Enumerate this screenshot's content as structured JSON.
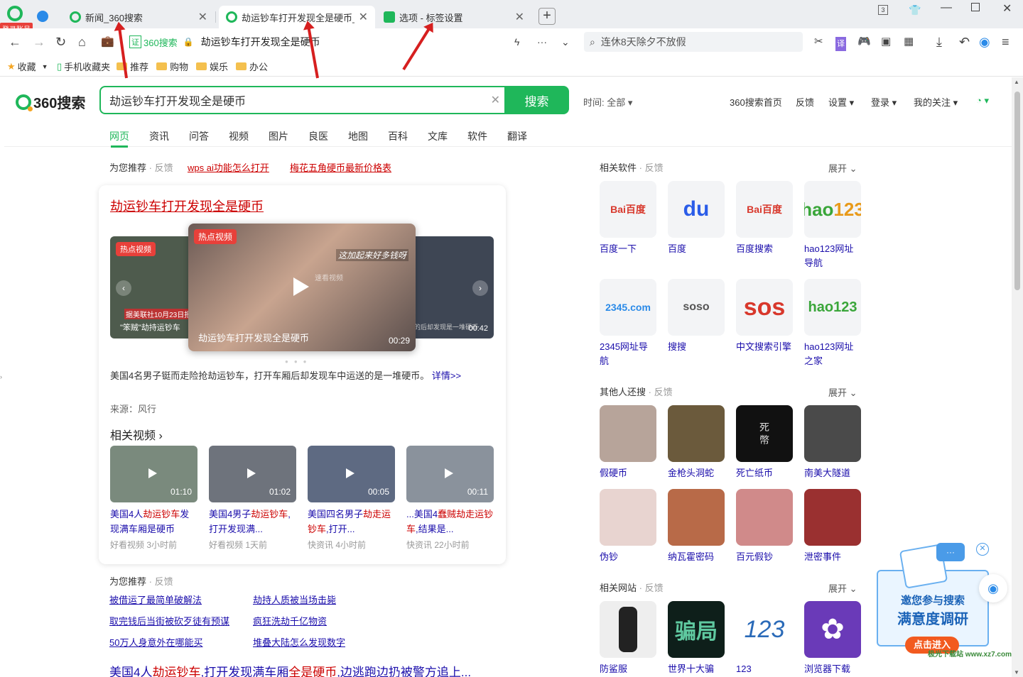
{
  "browser": {
    "login_badge": "登录账号",
    "tab_count": "3",
    "tabs": [
      {
        "title": "新闻_360搜索"
      },
      {
        "title": "劫运钞车打开发现全是硬币_36"
      },
      {
        "title": "选项 - 标签设置"
      }
    ],
    "address": {
      "site": "360搜索",
      "text": "劫运钞车打开发现全是硬币"
    },
    "side_search": "连休8天除夕不放假",
    "bookmarks": [
      "收藏",
      "手机收藏夹",
      "推荐",
      "购物",
      "娱乐",
      "办公"
    ]
  },
  "search": {
    "logo": "360搜索",
    "query": "劫运钞车打开发现全是硬币",
    "button": "搜索",
    "time_filter": "时间: 全部",
    "nav": [
      "360搜索首页",
      "反馈",
      "设置",
      "登录",
      "我的关注"
    ],
    "tabs": [
      "网页",
      "资讯",
      "问答",
      "视频",
      "图片",
      "良医",
      "地图",
      "百科",
      "文库",
      "软件",
      "翻译"
    ]
  },
  "recommend": {
    "label": "为您推荐",
    "feedback": "· 反馈",
    "links": [
      "wps ai功能怎么打开",
      "梅花五角硬币最新价格表"
    ]
  },
  "card": {
    "title": "劫运钞车打开发现全是硬币",
    "main_video": {
      "tag": "热点视频",
      "title": "劫运钞车打开发现全是硬币",
      "duration": "00:29",
      "caption": "这加起来好多钱呀",
      "watermark": "速看视频"
    },
    "left_video": {
      "tag": "热点视频",
      "caption": "\"笨贼\"劫持运钞车",
      "overlay": "据美联社10月23日报道"
    },
    "right_video": {
      "caption": "的后却发现是一堆硬币",
      "duration": "00:42"
    },
    "desc": "美国4名男子铤而走险抢劫运钞车，打开车厢后却发现车中运送的是一堆硬币。",
    "detail": "详情>>",
    "source": "来源：风行",
    "related_title": "相关视频",
    "related": [
      {
        "pre": "美国4人",
        "hl": "劫运钞车",
        "post": "发现满车厢是硬币",
        "src": "好看视频   3小时前",
        "dur": "01:10"
      },
      {
        "pre": "美国4男子",
        "hl": "劫运钞车",
        "post": ",打开发现满...",
        "src": "好看视频   1天前",
        "dur": "01:02"
      },
      {
        "pre": "美国四名男子",
        "hl": "劫走运钞车",
        "post": ",打开...",
        "src": "快资讯   4小时前",
        "dur": "00:05"
      },
      {
        "pre": "...美国4",
        "hl": "蠢贼劫走运钞车",
        "post": ",结果是...",
        "src": "快资讯   22小时前",
        "dur": "00:11"
      }
    ]
  },
  "recommend2": {
    "label": "为您推荐",
    "feedback": "· 反馈",
    "links": [
      "被借运了最简单破解法",
      "劫持人质被当场击毙",
      "取完钱后当街被砍歹徒有预谋",
      "疯狂洗劫千亿物资",
      "50万人身意外在哪能买",
      "堆叠大陆怎么发现数字"
    ]
  },
  "next_result": {
    "pre": "美国4人",
    "hl1": "劫运钞车",
    "mid": ",打开发现满车厢",
    "hl2": "全是硬币",
    "post": ",边逃跑边扔被警方追上..."
  },
  "sidebar": {
    "software": {
      "title": "相关软件",
      "feedback": "· 反馈",
      "expand": "展开",
      "items": [
        "百度一下",
        "百度",
        "百度搜索",
        "hao123网址导航",
        "2345网址导航",
        "搜搜",
        "中文搜索引擎",
        "hao123网址之家"
      ]
    },
    "others": {
      "title": "其他人还搜",
      "feedback": "· 反馈",
      "expand": "展开",
      "items": [
        "假硬币",
        "金枪头洞蛇",
        "死亡纸币",
        "南美大隧道",
        "伪钞",
        "纳瓦霍密码",
        "百元假钞",
        "泄密事件"
      ]
    },
    "sites": {
      "title": "相关网站",
      "feedback": "· 反馈",
      "expand": "展开",
      "items": [
        "防鲨服",
        "世界十大骗",
        "123",
        "浏览器下载"
      ]
    }
  },
  "survey": {
    "line1": "邀您参与搜索",
    "line2": "满意度调研",
    "button": "点击进入"
  },
  "watermark": "极光下载站 www.xz7.com",
  "colors": {
    "brand": "#1fb75a",
    "link": "#1a0dab",
    "highlight": "#cc0000",
    "annotation_arrow": "#d61f1f"
  }
}
